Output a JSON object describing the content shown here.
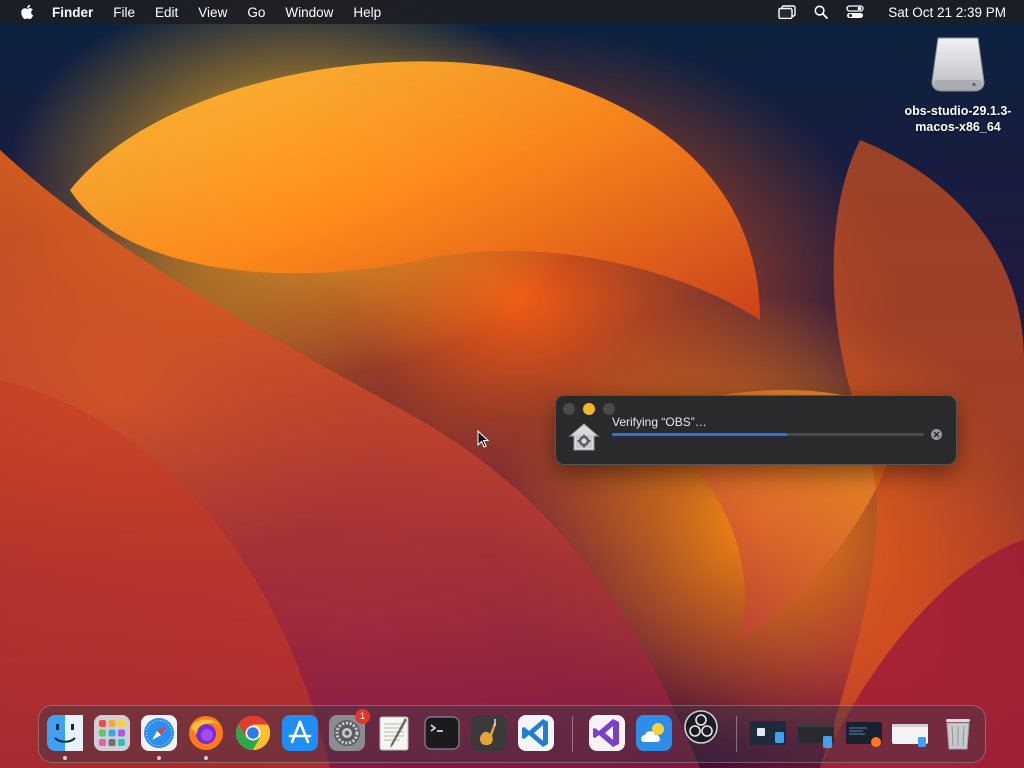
{
  "menubar": {
    "app_name": "Finder",
    "menus": [
      "File",
      "Edit",
      "View",
      "Go",
      "Window",
      "Help"
    ],
    "clock": "Sat Oct 21  2:39 PM"
  },
  "desktop_icon": {
    "label_line1": "obs-studio-29.1.3-",
    "label_line2": "macos-x86_64"
  },
  "verify_dialog": {
    "title": "Verifying “OBS”…",
    "progress_percent": 56
  },
  "dock": {
    "items": [
      {
        "name": "finder",
        "running": true
      },
      {
        "name": "launchpad",
        "running": false
      },
      {
        "name": "safari",
        "running": true
      },
      {
        "name": "firefox",
        "running": true
      },
      {
        "name": "chrome",
        "running": false
      },
      {
        "name": "app-store",
        "running": false
      },
      {
        "name": "system-settings",
        "running": false
      },
      {
        "name": "textedit",
        "running": false
      },
      {
        "name": "terminal",
        "running": false
      },
      {
        "name": "garageband",
        "running": false
      },
      {
        "name": "vscode",
        "running": false
      },
      {
        "name": "visual-studio",
        "running": false
      },
      {
        "name": "weather",
        "running": false
      },
      {
        "name": "obs",
        "running": false
      },
      {
        "name": "window-1",
        "running": false
      },
      {
        "name": "window-2",
        "running": false
      },
      {
        "name": "window-3",
        "running": false
      },
      {
        "name": "window-4",
        "running": false
      },
      {
        "name": "trash",
        "running": false
      }
    ],
    "settings_badge": "1"
  },
  "colors": {
    "accent_progress": "#2f6fe0",
    "minimize_yellow": "#f6b42a",
    "badge_red": "#e8332a"
  }
}
